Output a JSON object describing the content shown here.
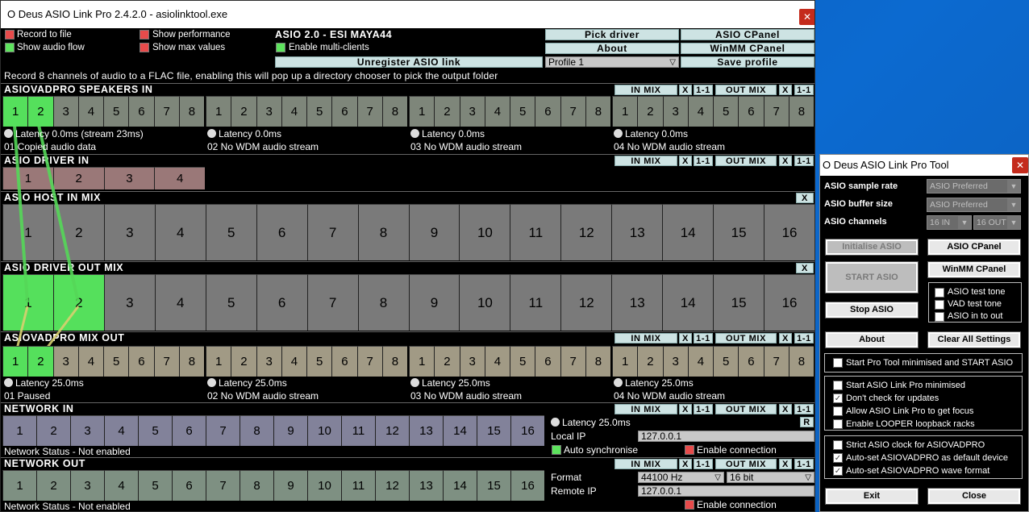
{
  "main": {
    "title": "O Deus ASIO Link Pro 2.4.2.0 - asiolinktool.exe",
    "options": {
      "record_to_file": "Record to file",
      "show_audio_flow": "Show audio flow",
      "show_performance": "Show performance",
      "show_max_values": "Show max values",
      "enable_multi_clients": "Enable multi-clients"
    },
    "driver_name": "ASIO 2.0 - ESI MAYA44",
    "buttons": {
      "pick_driver": "Pick driver",
      "asio_cpanel": "ASIO CPanel",
      "about": "About",
      "winmm_cpanel": "WinMM CPanel",
      "unregister": "Unregister ASIO link",
      "save_profile": "Save profile"
    },
    "profile": "Profile 1",
    "hint": "Record 8 channels of audio to a FLAC file, enabling this will pop up a directory chooser to pick the output folder",
    "mini": {
      "in_mix": "IN MIX",
      "x": "X",
      "one_one": "1-1",
      "out_mix": "OUT MIX",
      "r": "R"
    },
    "sections": {
      "speakers_in": "ASIOVADPRO SPEAKERS IN",
      "driver_in": "ASIO DRIVER IN",
      "host_in_mix": "ASIO HOST IN MIX",
      "driver_out_mix": "ASIO DRIVER OUT MIX",
      "mix_out": "ASIOVADPRO MIX OUT",
      "network_in": "NETWORK IN",
      "network_out": "NETWORK OUT"
    },
    "ch8": [
      "1",
      "2",
      "3",
      "4",
      "5",
      "6",
      "7",
      "8"
    ],
    "ch4": [
      "1",
      "2",
      "3",
      "4"
    ],
    "ch16": [
      "1",
      "2",
      "3",
      "4",
      "5",
      "6",
      "7",
      "8",
      "9",
      "10",
      "11",
      "12",
      "13",
      "14",
      "15",
      "16"
    ],
    "speakers_latency": [
      "Latency 0.0ms (stream 23ms)",
      "Latency 0.0ms",
      "Latency 0.0ms",
      "Latency 0.0ms"
    ],
    "speakers_status": [
      "01 Copied audio data",
      "02 No WDM audio stream",
      "03 No WDM audio stream",
      "04 No WDM audio stream"
    ],
    "mixout_latency": [
      "Latency 25.0ms",
      "Latency 25.0ms",
      "Latency 25.0ms",
      "Latency 25.0ms"
    ],
    "mixout_status": [
      "01 Paused",
      "02 No WDM audio stream",
      "03 No WDM audio stream",
      "04 No WDM audio stream"
    ],
    "network": {
      "in_status": "Network Status - Not enabled",
      "out_status": "Network Status - Not enabled",
      "latency": "Latency 25.0ms",
      "local_ip_label": "Local IP",
      "local_ip": "127.0.0.1",
      "auto_sync": "Auto synchronise",
      "enable_connection": "Enable connection",
      "format_label": "Format",
      "format_rate": "44100 Hz",
      "format_bits": "16 bit",
      "remote_ip_label": "Remote IP",
      "remote_ip": "127.0.0.1"
    },
    "colors": {
      "speakers": "#7e867a",
      "driver_in": "#9a7878",
      "host": "#7a7a7a",
      "mixout": "#a19a85",
      "netin": "#82829a",
      "netout": "#7e9082",
      "active": "#55e05c"
    }
  },
  "tool": {
    "title": "O Deus ASIO Link Pro Tool",
    "sample_rate_label": "ASIO sample rate",
    "sample_rate": "ASIO Preferred",
    "buffer_size_label": "ASIO buffer size",
    "buffer_size": "ASIO Preferred",
    "channels_label": "ASIO channels",
    "channels_in": "16 IN",
    "channels_out": "16 OUT",
    "buttons": {
      "initialise": "Initialise ASIO",
      "asio_cpanel": "ASIO CPanel",
      "winmm_cpanel": "WinMM CPanel",
      "start": "START ASIO",
      "stop": "Stop ASIO",
      "about": "About",
      "clear": "Clear All Settings",
      "exit": "Exit",
      "close": "Close"
    },
    "tests": [
      "ASIO test tone",
      "VAD test tone",
      "ASIO in to out"
    ],
    "start_pro_min": "Start Pro Tool minimised and START ASIO",
    "opts1": [
      "Start ASIO Link Pro minimised",
      "Don't check for updates",
      "Allow ASIO Link Pro to get focus",
      "Enable LOOPER loopback racks"
    ],
    "opts1_checked": [
      false,
      true,
      false,
      false
    ],
    "opts2": [
      "Strict ASIO clock for ASIOVADPRO",
      "Auto-set ASIOVADPRO as default device",
      "Auto-set ASIOVADPRO wave format"
    ],
    "opts2_checked": [
      false,
      true,
      true
    ]
  }
}
